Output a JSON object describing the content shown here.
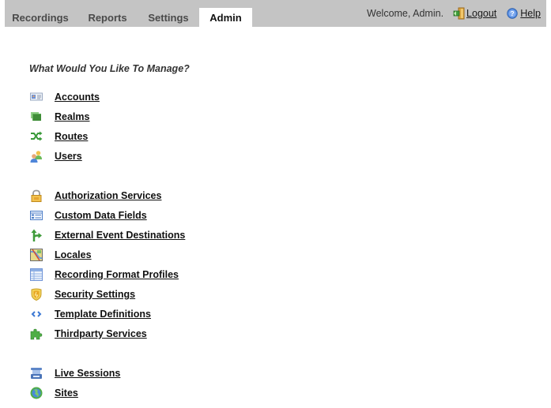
{
  "tabs": [
    {
      "label": "Recordings",
      "active": false
    },
    {
      "label": "Reports",
      "active": false
    },
    {
      "label": "Settings",
      "active": false
    },
    {
      "label": "Admin",
      "active": true
    }
  ],
  "userbar": {
    "welcome": "Welcome, Admin.",
    "logout": {
      "label": "Logout",
      "icon": "logout-door-icon"
    },
    "help": {
      "label": "Help",
      "icon": "help-icon"
    }
  },
  "main": {
    "heading": "What Would You Like To Manage?",
    "groups": [
      {
        "items": [
          {
            "label": "Accounts",
            "icon": "accounts-card-icon"
          },
          {
            "label": "Realms",
            "icon": "realms-icon"
          },
          {
            "label": "Routes",
            "icon": "routes-shuffle-icon"
          },
          {
            "label": "Users",
            "icon": "users-icon"
          }
        ]
      },
      {
        "items": [
          {
            "label": "Authorization Services",
            "icon": "lock-icon"
          },
          {
            "label": "Custom Data Fields",
            "icon": "form-fields-icon"
          },
          {
            "label": "External Event Destinations",
            "icon": "branch-arrow-icon"
          },
          {
            "label": "Locales",
            "icon": "map-icon"
          },
          {
            "label": "Recording Format Profiles",
            "icon": "table-icon"
          },
          {
            "label": "Security Settings",
            "icon": "shield-icon"
          },
          {
            "label": "Template Definitions",
            "icon": "code-brackets-icon"
          },
          {
            "label": "Thirdparty Services",
            "icon": "puzzle-icon"
          }
        ]
      },
      {
        "items": [
          {
            "label": "Live Sessions",
            "icon": "live-sessions-icon"
          },
          {
            "label": "Sites",
            "icon": "globe-icon"
          }
        ]
      }
    ]
  },
  "colors": {
    "header_bg": "#c4c4c4",
    "active_tab_bg": "#ffffff",
    "link_text": "#111111"
  }
}
